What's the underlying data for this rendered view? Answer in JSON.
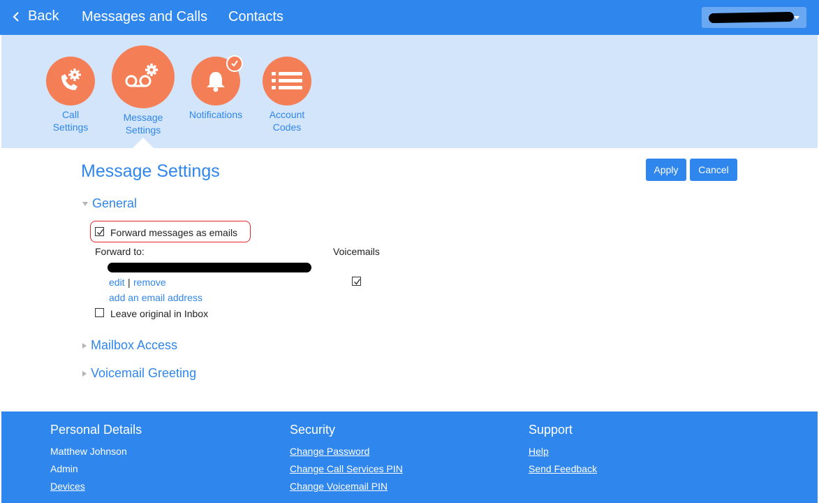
{
  "colors": {
    "primary": "#2f86ec",
    "accent": "#f47f57",
    "band": "#d3e5fa",
    "highlight": "#e8242a"
  },
  "topbar": {
    "back_label": "Back",
    "nav": [
      "Messages and Calls",
      "Contacts"
    ],
    "user_menu_icon": "chevron-down-icon"
  },
  "settings_nav": [
    {
      "line1": "Call",
      "line2": "Settings",
      "icon": "phone-gear-icon"
    },
    {
      "line1": "Message",
      "line2": "Settings",
      "icon": "voicemail-gear-icon"
    },
    {
      "line1": "Notifications",
      "line2": "",
      "icon": "bell-icon"
    },
    {
      "line1": "Account",
      "line2": "Codes",
      "icon": "list-icon"
    }
  ],
  "main": {
    "title": "Message Settings",
    "apply_label": "Apply",
    "cancel_label": "Cancel",
    "sections": [
      {
        "label": "General",
        "expanded": true
      },
      {
        "label": "Mailbox Access",
        "expanded": false
      },
      {
        "label": "Voicemail Greeting",
        "expanded": false
      }
    ],
    "general": {
      "forward_label": "Forward messages as emails",
      "forward_checked": true,
      "forward_to_label": "Forward to:",
      "voicemails_label": "Voicemails",
      "voicemails_checked": true,
      "edit_label": "edit",
      "separator": "|",
      "remove_label": "remove",
      "add_email_label": "add an email address",
      "leave_original_label": "Leave original in Inbox",
      "leave_original_checked": false
    }
  },
  "footer": {
    "personal": {
      "title": "Personal Details",
      "items": [
        "Matthew Johnson",
        "Admin",
        "Devices"
      ]
    },
    "security": {
      "title": "Security",
      "items": [
        "Change Password",
        "Change Call Services PIN",
        "Change Voicemail PIN"
      ]
    },
    "support": {
      "title": "Support",
      "items": [
        "Help",
        "Send Feedback"
      ]
    }
  }
}
